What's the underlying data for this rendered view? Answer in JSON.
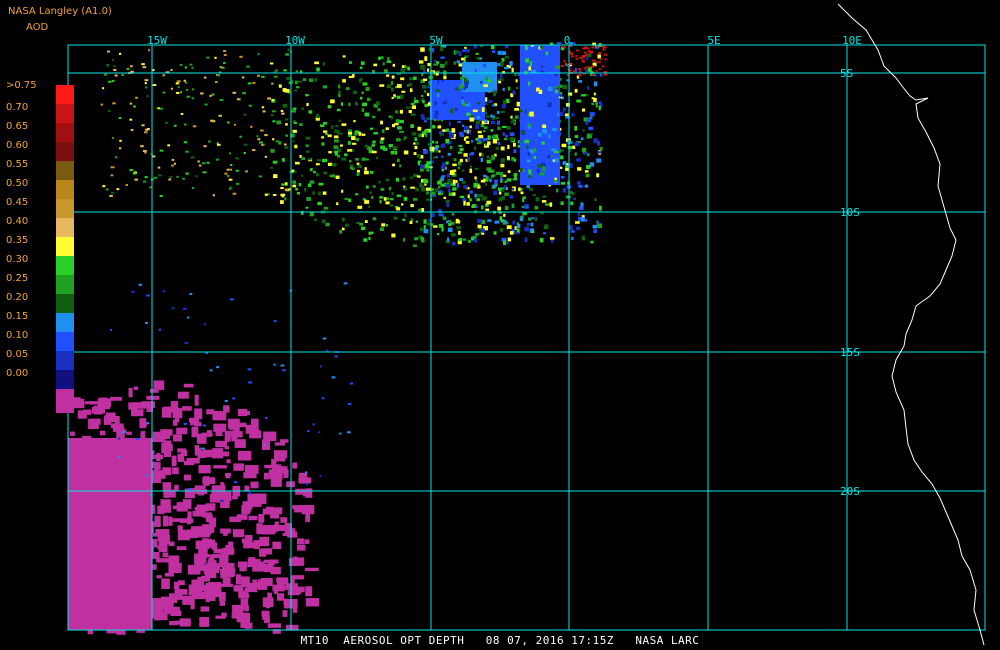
{
  "header": {
    "source": "NASA Langley (A1.0)",
    "product": "AOD"
  },
  "legend": {
    "labels": [
      ">0.75",
      "0.70",
      "0.65",
      "0.60",
      "0.55",
      "0.50",
      "0.45",
      "0.40",
      "0.35",
      "0.30",
      "0.25",
      "0.20",
      "0.15",
      "0.10",
      "0.05",
      "0.00"
    ],
    "colors": [
      "#ff1a1a",
      "#c81414",
      "#a01010",
      "#7a1010",
      "#7a5a10",
      "#b8861a",
      "#c8962a",
      "#e8b860",
      "#ffff30",
      "#28d028",
      "#20a020",
      "#106010",
      "#2090f0",
      "#2050ff",
      "#1830c0",
      "#101080",
      "#c030a0"
    ]
  },
  "map": {
    "longitude_labels": [
      "15W",
      "10W",
      "5W",
      "0",
      "5E",
      "10E"
    ],
    "latitude_labels": [
      "5S",
      "10S",
      "15S",
      "20S"
    ],
    "grid_color": "#00e6e6",
    "coast_color": "#ffffff"
  },
  "footer": {
    "caption": "MT10  AEROSOL OPT DEPTH   08 07, 2016 17:15Z   NASA LARC"
  }
}
